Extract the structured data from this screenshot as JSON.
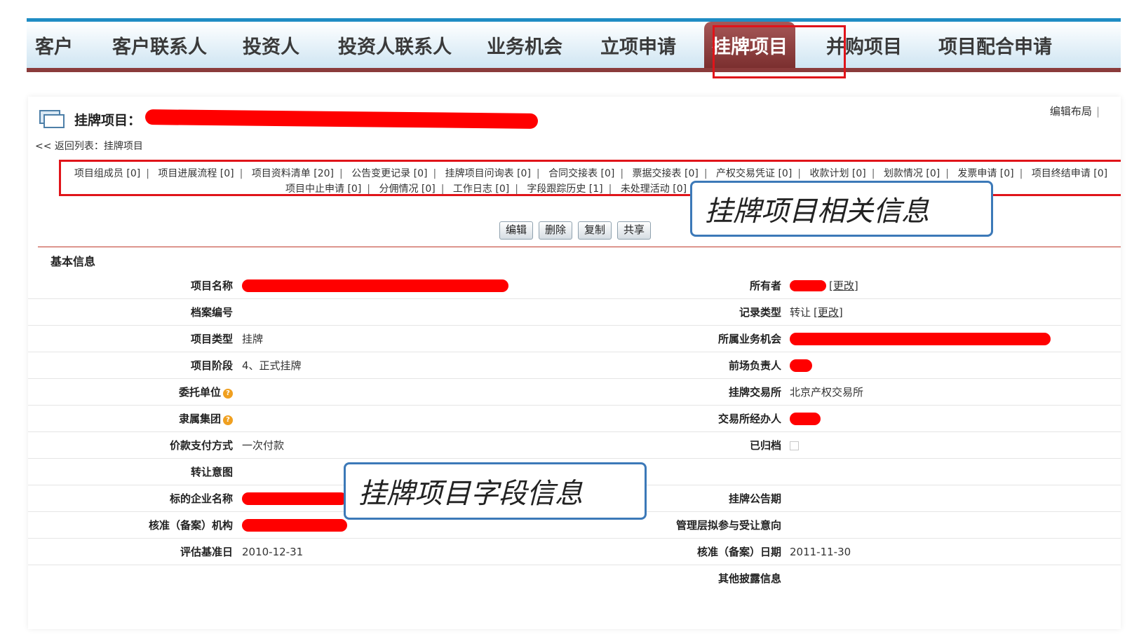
{
  "nav": {
    "items": [
      "客户",
      "客户联系人",
      "投资人",
      "投资人联系人",
      "业务机会",
      "立项申请",
      "挂牌项目",
      "并购项目",
      "项目配合申请"
    ],
    "active": "挂牌项目"
  },
  "header": {
    "title_label": "挂牌项目：",
    "edit_layout": "编辑布局",
    "edit_layout_sep": "|",
    "back_link": "<< 返回列表：挂牌项目"
  },
  "related": {
    "line1": [
      "项目组成员 [0]",
      "项目进展流程 [0]",
      "项目资料清单 [20]",
      "公告变更记录 [0]",
      "挂牌项目问询表 [0]",
      "合同交接表 [0]",
      "票据交接表 [0]",
      "产权交易凭证 [0]",
      "收款计划 [0]",
      "划款情况 [0]",
      "发票申请 [0]",
      "项目终结申请 [0]"
    ],
    "line2": [
      "项目中止申请 [0]",
      "分佣情况 [0]",
      "工作日志 [0]",
      "字段跟踪历史 [1]",
      "未处理活动 [0]"
    ]
  },
  "callouts": {
    "related_info": "挂牌项目相关信息",
    "field_info": "挂牌项目字段信息"
  },
  "actions": {
    "edit": "编辑",
    "delete": "删除",
    "copy": "复制",
    "share": "共享"
  },
  "section": {
    "title": "基本信息"
  },
  "fields": {
    "project_name": {
      "label": "项目名称",
      "value": ""
    },
    "owner": {
      "label": "所有者",
      "change": "[更改]"
    },
    "archive_no": {
      "label": "档案编号",
      "value": ""
    },
    "record_type": {
      "label": "记录类型",
      "value": "转让",
      "change": "[更改]"
    },
    "project_type": {
      "label": "项目类型",
      "value": "挂牌"
    },
    "business_opportunity": {
      "label": "所属业务机会",
      "value": ""
    },
    "project_stage": {
      "label": "项目阶段",
      "value": "4、正式挂牌"
    },
    "front_lead": {
      "label": "前场负责人",
      "value": ""
    },
    "entrusting_unit": {
      "label": "委托单位",
      "value": ""
    },
    "exchange": {
      "label": "挂牌交易所",
      "value": "北京产权交易所"
    },
    "group": {
      "label": "隶属集团",
      "value": ""
    },
    "exchange_agent": {
      "label": "交易所经办人",
      "value": ""
    },
    "payment_method": {
      "label": "价款支付方式",
      "value": "一次付款"
    },
    "archived": {
      "label": "已归档",
      "checked": false
    },
    "transfer_intent": {
      "label": "转让意图",
      "value": ""
    },
    "target_company": {
      "label": "标的企业名称",
      "value": ""
    },
    "announcement_period": {
      "label": "挂牌公告期",
      "value": ""
    },
    "approval_agency": {
      "label": "核准（备案）机构",
      "value": ""
    },
    "management_intent": {
      "label": "管理层拟参与受让意向",
      "value": ""
    },
    "valuation_date": {
      "label": "评估基准日",
      "value": "2010-12-31"
    },
    "approval_date": {
      "label": "核准（备案）日期",
      "value": "2011-11-30"
    },
    "other_disclosure": {
      "label": "其他披露信息",
      "value": ""
    }
  },
  "colors": {
    "nav_accent": "#1f8cc4",
    "active_tab": "#8a3b3b",
    "highlight_box": "#e0141a",
    "callout_border": "#3c79b8",
    "redaction": "#ff0000"
  },
  "icons": [
    "record-icon",
    "help-icon"
  ]
}
